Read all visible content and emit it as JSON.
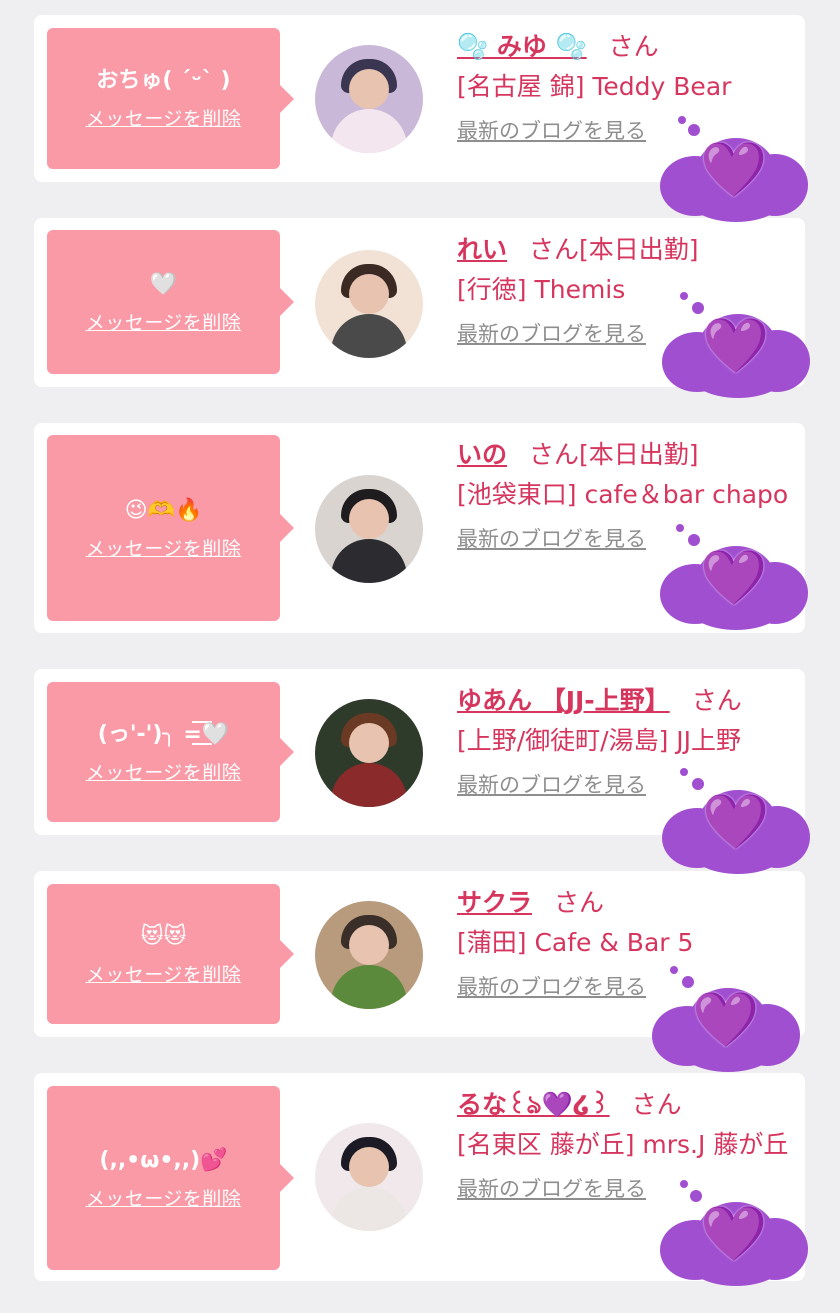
{
  "cards": [
    {
      "message": "おちゅ( ´ᵕ` )",
      "delete_label": "メッセージを削除",
      "name": "🫧 みゆ 🫧",
      "san": "さん",
      "shop": "[名古屋 錦] Teddy Bear",
      "blog_label": "最新のブログを見る",
      "avatar_colors": [
        "#c9b8d8",
        "#3a3550",
        "#f3e6ef"
      ]
    },
    {
      "message": "🤍",
      "delete_label": "メッセージを削除",
      "name": "れい",
      "san": "さん[本日出勤]",
      "shop": "[行徳] Themis",
      "blog_label": "最新のブログを見る",
      "avatar_colors": [
        "#f2e2d6",
        "#3b2a24",
        "#4a4a4a"
      ]
    },
    {
      "message": "😉🫶🔥",
      "delete_label": "メッセージを削除",
      "name": "いの",
      "san": "さん[本日出勤]",
      "shop": "[池袋東口] cafe＆bar chapo",
      "blog_label": "最新のブログを見る",
      "avatar_colors": [
        "#d9d4d0",
        "#1e1c1f",
        "#2c2c30"
      ]
    },
    {
      "message": "(っ'-')╮ =͟͟͞͞🤍",
      "delete_label": "メッセージを削除",
      "name": "ゆあん 【JJ-上野】",
      "san": "さん",
      "shop": "[上野/御徒町/湯島] JJ上野",
      "blog_label": "最新のブログを見る",
      "avatar_colors": [
        "#2e3a2a",
        "#6b3a24",
        "#8a2a2a"
      ]
    },
    {
      "message": "😻😻",
      "delete_label": "メッセージを削除",
      "name": "サクラ",
      "san": "さん",
      "shop": "[蒲田] Cafe & Bar 5",
      "blog_label": "最新のブログを見る",
      "avatar_colors": [
        "#b89a7c",
        "#3a2e28",
        "#5b8a3c"
      ]
    },
    {
      "message": "(,,•ω•,,)💕",
      "delete_label": "メッセージを削除",
      "name": "るな꒰ঌ💜໒꒱",
      "san": "さん",
      "shop": "[名東区 藤が丘] mrs.J 藤が丘",
      "blog_label": "最新のブログを見る",
      "avatar_colors": [
        "#f0e8ea",
        "#1c1a24",
        "#ece6e4"
      ]
    }
  ],
  "accent_colors": {
    "bubble": "#fa9aa7",
    "name_text": "#d6365e",
    "link_gray": "#8e8e8e",
    "thought_cloud": "#a04fd0",
    "heart": "#c99bff"
  },
  "thought_heart_glyph": "💜"
}
